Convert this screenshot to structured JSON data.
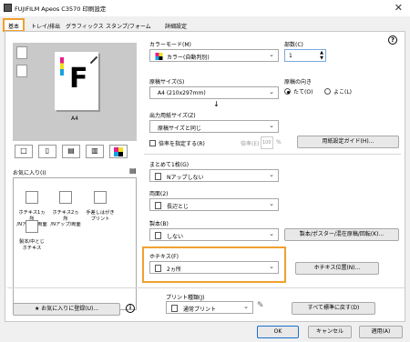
{
  "window": {
    "title": "FUJIFILM Apeos C3570 印刷設定",
    "close_symbol": "✕"
  },
  "tabs": [
    {
      "label": "基本"
    },
    {
      "label": "トレイ/排出"
    },
    {
      "label": "グラフィックス"
    },
    {
      "label": "スタンプ/フォーム"
    },
    {
      "label": "詳細設定"
    }
  ],
  "help_symbol": "?",
  "preview": {
    "paper_size": "A4",
    "glyph": "F"
  },
  "favorites": {
    "label": "お気に入り(I)",
    "items": [
      {
        "label": "ホチキス1ヵ所\n/Nアップ/両面"
      },
      {
        "label": "ホチキス2ヵ所\n/Nアップ/両面"
      },
      {
        "label": "手差しはがき\nプリント"
      },
      {
        "label": "製本/中とじ\nホチキス"
      }
    ],
    "save_button": "お気に入りに登録(U)..."
  },
  "color_mode": {
    "label": "カラーモード(M)",
    "value": "カラー(自動判別)"
  },
  "copies": {
    "label": "部数(C)",
    "value": "1"
  },
  "original_size": {
    "label": "原稿サイズ(S)",
    "value": "A4 (210x297mm)"
  },
  "orientation": {
    "label": "原稿の向き",
    "options": [
      "たて(O)",
      "よこ(L)"
    ],
    "selected": 0
  },
  "output_size": {
    "label": "出力用紙サイズ(Z)",
    "value": "原稿サイズと同じ"
  },
  "zoom": {
    "checkbox_label": "倍率を指定する(R)",
    "ratio_label": "倍率(E)",
    "value": "100",
    "unit": "%"
  },
  "paper_guide_button": "用紙設定ガイド(H)...",
  "nup": {
    "label": "まとめて1枚(G)",
    "value": "Nアップしない"
  },
  "duplex": {
    "label": "両面(2)",
    "value": "長辺とじ"
  },
  "booklet": {
    "label": "製本(B)",
    "value": "しない",
    "button": "製本/ポスター/混在原稿/回転(K)..."
  },
  "staple": {
    "label": "ホチキス(F)",
    "value": "2ヵ所",
    "button": "ホチキス位置(N)..."
  },
  "print_type": {
    "label": "プリント種類(J)",
    "value": "通常プリント"
  },
  "reset_button": "すべて標準に戻す(D)",
  "footer": {
    "ok": "OK",
    "cancel": "キャンセル",
    "apply": "適用(A)"
  },
  "colors": {
    "highlight": "#f0a030",
    "accent": "#1a6fd0"
  }
}
